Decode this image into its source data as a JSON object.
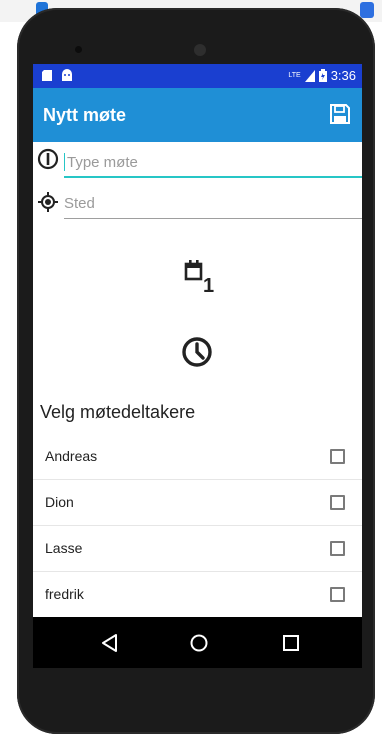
{
  "statusbar": {
    "time": "3:36",
    "network": "LTE"
  },
  "appbar": {
    "title": "Nytt møte"
  },
  "form": {
    "title_placeholder": "Type møte",
    "location_placeholder": "Sted",
    "date_badge": "1"
  },
  "participants": {
    "heading": "Velg møtedeltakere",
    "items": [
      {
        "name": "Andreas"
      },
      {
        "name": "Dion"
      },
      {
        "name": "Lasse"
      },
      {
        "name": "fredrik"
      }
    ]
  },
  "colors": {
    "statusbar": "#1a3fd0",
    "appbar": "#1f8fd6",
    "accent": "#26c6c6"
  }
}
